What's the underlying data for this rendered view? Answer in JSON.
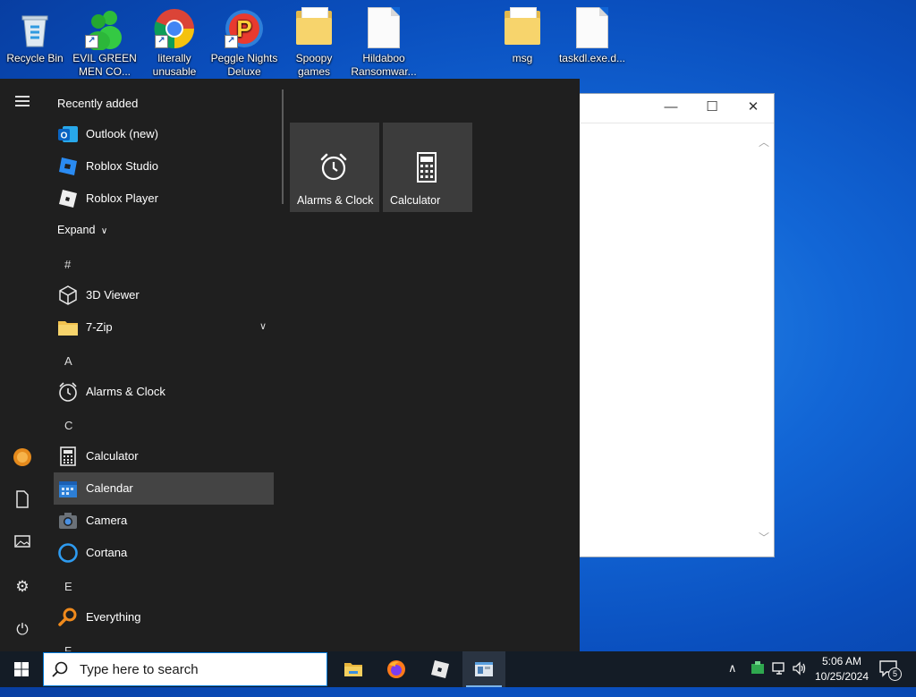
{
  "desktop": {
    "icons": [
      {
        "label": "Recycle Bin"
      },
      {
        "label": "EVIL GREEN MEN CO..."
      },
      {
        "label": "literally unusable"
      },
      {
        "label": "Peggle Nights Deluxe"
      },
      {
        "label": "Spoopy games"
      },
      {
        "label": "Hildaboo Ransomwar..."
      },
      {
        "label": "msg"
      },
      {
        "label": "taskdl.exe.d..."
      }
    ]
  },
  "start_menu": {
    "recently_added_header": "Recently added",
    "recent": [
      {
        "label": "Outlook (new)",
        "icon": "outlook-icon"
      },
      {
        "label": "Roblox Studio",
        "icon": "roblox-studio-icon"
      },
      {
        "label": "Roblox Player",
        "icon": "roblox-player-icon"
      }
    ],
    "expand_label": "Expand",
    "groups": [
      {
        "letter": "#",
        "items": [
          {
            "label": "3D Viewer"
          },
          {
            "label": "7-Zip"
          }
        ]
      },
      {
        "letter": "A",
        "items": [
          {
            "label": "Alarms & Clock"
          }
        ]
      },
      {
        "letter": "C",
        "items": [
          {
            "label": "Calculator"
          },
          {
            "label": "Calendar"
          },
          {
            "label": "Camera"
          },
          {
            "label": "Cortana"
          }
        ]
      },
      {
        "letter": "E",
        "items": [
          {
            "label": "Everything"
          }
        ]
      },
      {
        "letter": "F",
        "items": []
      }
    ],
    "selected_item": "Calendar",
    "tiles": [
      {
        "label": "Alarms & Clock",
        "icon": "alarm-clock-icon"
      },
      {
        "label": "Calculator",
        "icon": "calculator-icon"
      }
    ]
  },
  "taskbar": {
    "search_placeholder": "Type here to search",
    "pinned": [
      "file-explorer-icon",
      "firefox-icon",
      "roblox-icon",
      "app-window-icon"
    ],
    "clock": {
      "time": "5:06 AM",
      "date": "10/25/2024"
    },
    "notification_count": "5"
  },
  "colors": {
    "accent": "#0078d7",
    "start_bg": "#1f1f1f",
    "tile_bg": "#3c3c3c",
    "taskbar_bg": "#141c26"
  }
}
